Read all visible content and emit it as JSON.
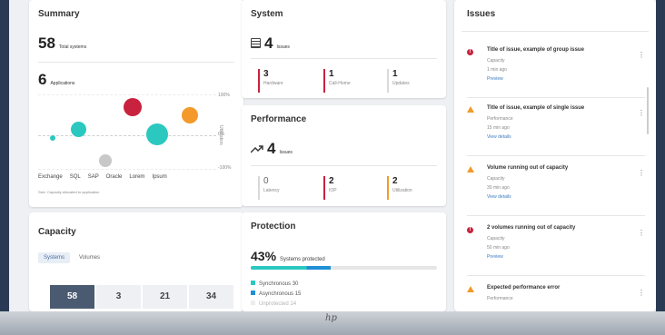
{
  "summary": {
    "title": "Summary",
    "systems_count": "58",
    "systems_label": "Total systems",
    "apps_count": "6",
    "apps_label": "Applications",
    "chart_y_top": "100%",
    "chart_y_mid": "0%",
    "chart_y_bottom": "-100%",
    "chart_y_axis_title": "Utilization",
    "x_labels": [
      "Exchange",
      "SQL",
      "SAP",
      "Oracle",
      "Lorem",
      "Ipsum"
    ],
    "footnote": "Size: Capacity allocated to application",
    "colors": {
      "teal": "#2bc8c0",
      "red": "#c8223e",
      "orange": "#f39a2b",
      "gray": "#c8c8c8"
    }
  },
  "system": {
    "title": "System",
    "issues_count": "4",
    "issues_label": "Issues",
    "stats": [
      {
        "value": "3",
        "label": "Hardware",
        "color": "#c8223e"
      },
      {
        "value": "1",
        "label": "Call-Home",
        "color": "#c8223e"
      },
      {
        "value": "1",
        "label": "Updates",
        "color": "#d9d9d9"
      }
    ]
  },
  "performance": {
    "title": "Performance",
    "issues_count": "4",
    "issues_label": "Issues",
    "stats": [
      {
        "value": "0",
        "label": "Latency",
        "color": "#d9d9d9"
      },
      {
        "value": "2",
        "label": "IOP",
        "color": "#c8223e"
      },
      {
        "value": "2",
        "label": "Utilization",
        "color": "#f39a2b"
      }
    ]
  },
  "capacity": {
    "title": "Capacity",
    "tabs": [
      "Systems",
      "Volumes"
    ],
    "values": [
      "58",
      "3",
      "21",
      "34"
    ]
  },
  "protection": {
    "title": "Protection",
    "percent": "43%",
    "percent_label": "Systems protected",
    "progress": 0.43,
    "legend": [
      {
        "label": "Synchronous",
        "value": "30",
        "color": "#2bc8c0"
      },
      {
        "label": "Asynchronous",
        "value": "15",
        "color": "#1f8fd6"
      },
      {
        "label": "Unprotected",
        "value": "14",
        "color": "#d9d9d9"
      }
    ]
  },
  "issues": {
    "title": "Issues",
    "items": [
      {
        "title": "Title of issue, example of group issue",
        "sub": "Capacity",
        "time": "1 min ago",
        "action": "Preview",
        "severity": "error"
      },
      {
        "title": "Title of issue, example of single issue",
        "sub": "Performance",
        "time": "15 min ago",
        "action": "View details",
        "severity": "warning"
      },
      {
        "title": "Volume running out of capacity",
        "sub": "Capacity",
        "time": "30 min ago",
        "action": "View details",
        "severity": "warning"
      },
      {
        "title": "2 volumes running out of capacity",
        "sub": "Capacity",
        "time": "50 min ago",
        "action": "Preview",
        "severity": "error"
      },
      {
        "title": "Expected performance error",
        "sub": "Performance",
        "time": "",
        "action": "",
        "severity": "warning"
      }
    ]
  },
  "device": {
    "logo": "hp"
  }
}
